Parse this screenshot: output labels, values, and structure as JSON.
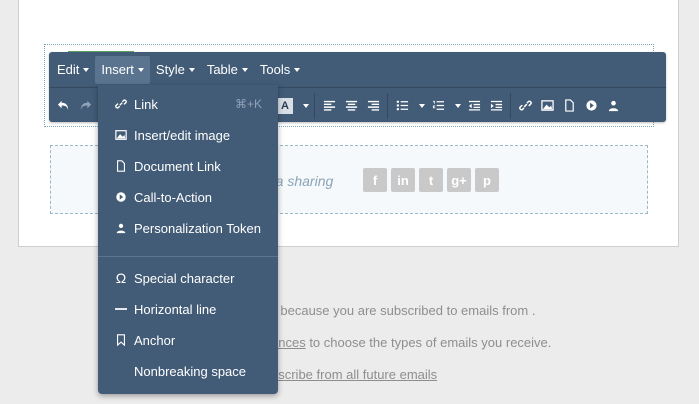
{
  "menubar": {
    "items": [
      {
        "label": "Edit"
      },
      {
        "label": "Insert"
      },
      {
        "label": "Style"
      },
      {
        "label": "Table"
      },
      {
        "label": "Tools"
      }
    ]
  },
  "toolbar": {
    "font_color_label": "A"
  },
  "insert_menu": {
    "items": [
      {
        "label": "Link",
        "shortcut": "⌘+K",
        "icon": "link-icon"
      },
      {
        "label": "Insert/edit image",
        "icon": "image-icon"
      },
      {
        "label": "Document Link",
        "icon": "document-icon"
      },
      {
        "label": "Call-to-Action",
        "icon": "cta-icon"
      },
      {
        "label": "Personalization Token",
        "icon": "person-icon"
      },
      {
        "label": "Special character",
        "icon": "omega-icon"
      },
      {
        "label": "Horizontal line",
        "icon": "horizontal-line-icon"
      },
      {
        "label": "Anchor",
        "icon": "bookmark-icon"
      },
      {
        "label": "Nonbreaking space",
        "icon": ""
      }
    ]
  },
  "footer": {
    "social_text": "edia sharing",
    "social_icons": [
      "f",
      "in",
      "t",
      "g+",
      "p"
    ],
    "line1": "il because you are subscribed to emails from .",
    "line2_link": "ences",
    "line2_rest": " to choose the types of emails you receive.",
    "line3_link": "bscribe from all future emails"
  },
  "colors": {
    "toolbar_bg": "#425b76",
    "accent_green": "#5fa55a"
  }
}
